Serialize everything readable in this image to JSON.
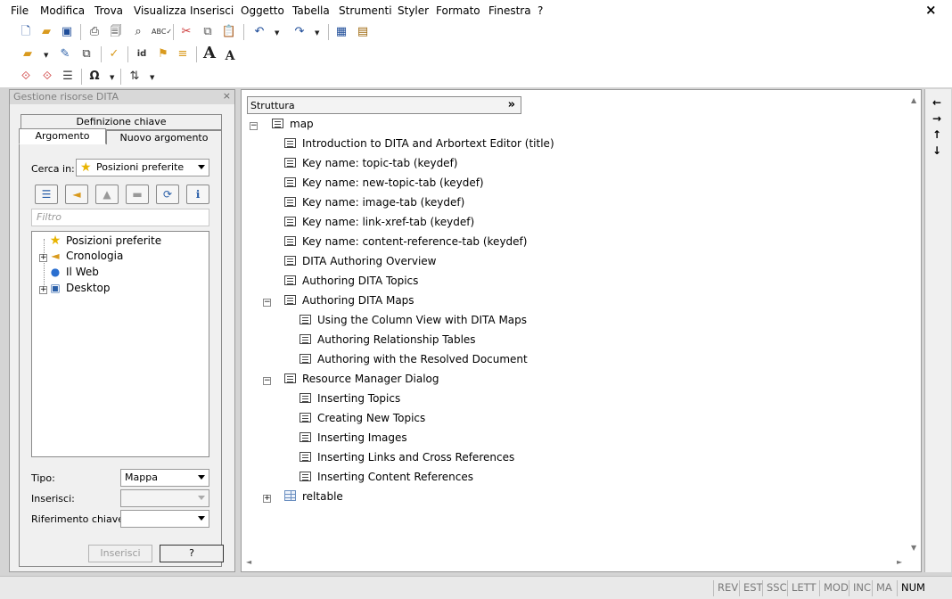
{
  "menu": [
    "File",
    "Modifica",
    "Trova",
    "Visualizza",
    "Inserisci",
    "Oggetto",
    "Tabella",
    "Strumenti",
    "Styler",
    "Formato",
    "Finestra",
    "?"
  ],
  "window_close": "×",
  "toolbar1": [
    "new-document-icon",
    "open-folder-icon",
    "save-icon",
    "print-icon",
    "print-preview-icon",
    "find-icon",
    "spell-check-icon",
    "cut-icon",
    "copy-icon",
    "paste-icon",
    "undo-icon",
    "redo-icon",
    "table-grid-icon",
    "document-properties-icon"
  ],
  "toolbar2": [
    "insert-markup-icon",
    "edit-attributes-icon",
    "change-markup-icon",
    "copy-markup-icon",
    "validate-icon",
    "id-icon",
    "tag-icon",
    "style-icon",
    "bigger-font-icon",
    "smaller-font-icon"
  ],
  "toolbar2_labels": {
    "font_up": "A",
    "font_down": "A",
    "id": "id"
  },
  "toolbar3": [
    "tag-view-icon",
    "markup-icon",
    "list-icon",
    "special-character-icon",
    "sort-icon"
  ],
  "toolbar3_labels": {
    "omega": "Ω"
  },
  "dock": {
    "title": "Gestione risorse DITA",
    "close": "×",
    "tabs": {
      "key_definition": "Definizione chiave",
      "topic": "Argomento",
      "new_topic": "Nuovo argomento"
    },
    "search_in_label": "Cerca in:",
    "search_in_value": "Posizioni preferite",
    "filter_placeholder": "Filtro",
    "tree": [
      {
        "label": "Posizioni preferite",
        "icon": "star-icon"
      },
      {
        "label": "Cronologia",
        "icon": "history-icon"
      },
      {
        "label": "Il Web",
        "icon": "globe-icon"
      },
      {
        "label": "Desktop",
        "icon": "desktop-icon"
      }
    ],
    "type_label": "Tipo:",
    "type_value": "Mappa",
    "insert_label": "Inserisci:",
    "insert_value": "",
    "keyref_label": "Riferimento chiave:",
    "keyref_value": "",
    "insert_button": "Inserisci",
    "help_button": "?"
  },
  "editor": {
    "structure_header": "Struttura",
    "structure_chevron": "»",
    "tree": [
      {
        "label": "map",
        "level": 0,
        "icon": "doc",
        "expander": "−"
      },
      {
        "label": "Introduction to DITA and Arbortext Editor (title)",
        "level": 1,
        "icon": "doc"
      },
      {
        "label": "Key name: topic-tab (keydef)",
        "level": 1,
        "icon": "doc"
      },
      {
        "label": "Key name: new-topic-tab (keydef)",
        "level": 1,
        "icon": "doc"
      },
      {
        "label": "Key name: image-tab (keydef)",
        "level": 1,
        "icon": "doc"
      },
      {
        "label": "Key name: link-xref-tab (keydef)",
        "level": 1,
        "icon": "doc"
      },
      {
        "label": "Key name: content-reference-tab (keydef)",
        "level": 1,
        "icon": "doc"
      },
      {
        "label": "DITA Authoring Overview",
        "level": 1,
        "icon": "doc"
      },
      {
        "label": "Authoring DITA Topics",
        "level": 1,
        "icon": "doc"
      },
      {
        "label": "Authoring DITA Maps",
        "level": 1,
        "icon": "doc",
        "expander": "−"
      },
      {
        "label": "Using the Column View with DITA Maps",
        "level": 2,
        "icon": "doc"
      },
      {
        "label": "Authoring Relationship Tables",
        "level": 2,
        "icon": "doc"
      },
      {
        "label": "Authoring with the Resolved Document",
        "level": 2,
        "icon": "doc"
      },
      {
        "label": "Resource Manager Dialog",
        "level": 1,
        "icon": "doc",
        "expander": "−"
      },
      {
        "label": "Inserting Topics",
        "level": 2,
        "icon": "doc"
      },
      {
        "label": "Creating New Topics",
        "level": 2,
        "icon": "doc"
      },
      {
        "label": "Inserting Images",
        "level": 2,
        "icon": "doc"
      },
      {
        "label": "Inserting Links and Cross References",
        "level": 2,
        "icon": "doc"
      },
      {
        "label": "Inserting Content References",
        "level": 2,
        "icon": "doc"
      },
      {
        "label": "reltable",
        "level": 1,
        "icon": "table",
        "expander": "+"
      }
    ]
  },
  "side_arrows": [
    "←",
    "→",
    "↑",
    "↓"
  ],
  "status": [
    {
      "label": "REV",
      "active": false
    },
    {
      "label": "EST",
      "active": false
    },
    {
      "label": "SSC",
      "active": false
    },
    {
      "label": "LETT",
      "active": false
    },
    {
      "label": "MOD",
      "active": false
    },
    {
      "label": "INC",
      "active": false
    },
    {
      "label": "MA",
      "active": false
    },
    {
      "label": "NUM",
      "active": true
    }
  ]
}
